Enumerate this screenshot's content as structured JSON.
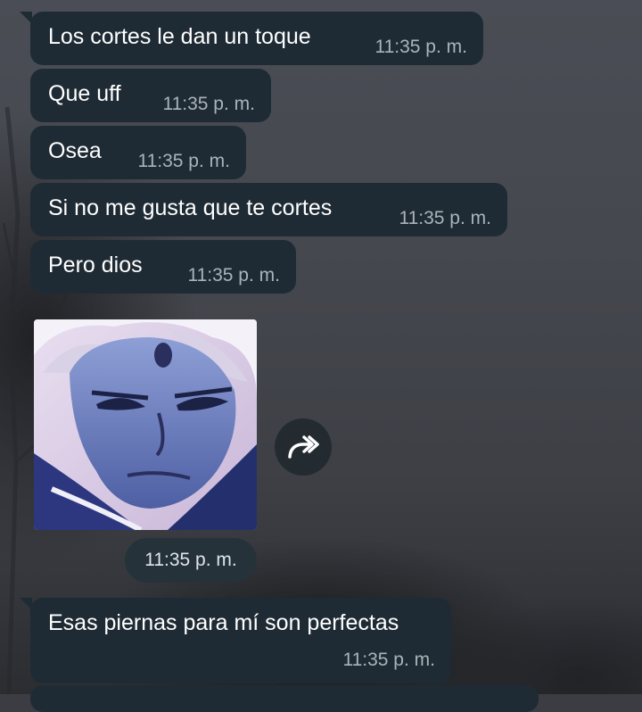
{
  "messages": [
    {
      "text": "Los cortes le dan un toque",
      "time": "11:35 p. m."
    },
    {
      "text": "Que uff",
      "time": "11:35 p. m."
    },
    {
      "text": "Osea",
      "time": "11:35 p. m."
    },
    {
      "text": "Si no me gusta que te cortes",
      "time": "11:35 p. m."
    },
    {
      "text": "Pero dios",
      "time": "11:35 p. m."
    }
  ],
  "media": {
    "image_icon": "anime-character-portrait",
    "forward_icon": "forward-arrow-icon",
    "time": "11:35 p. m."
  },
  "last_message": {
    "text": "Esas piernas para mí son perfectas",
    "time": "11:35 p. m."
  },
  "colors": {
    "bubble": "#1f2b34",
    "timestamp": "#aab3ba",
    "background": "#3b3d43"
  }
}
